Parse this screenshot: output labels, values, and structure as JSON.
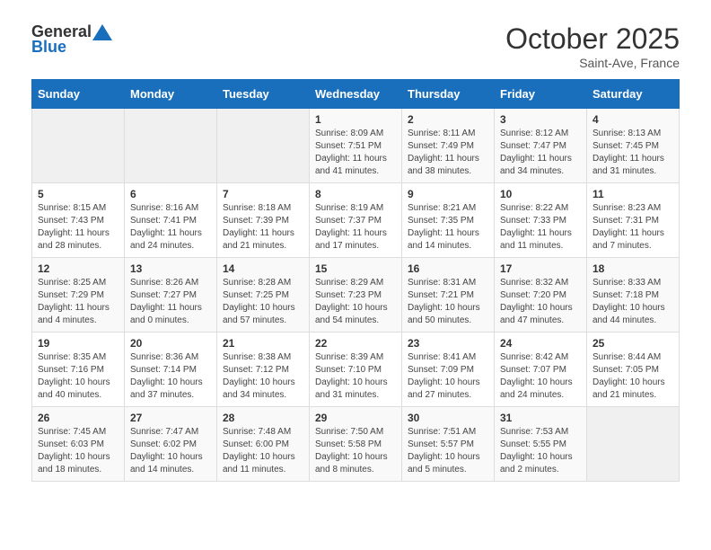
{
  "header": {
    "logo_general": "General",
    "logo_blue": "Blue",
    "month_title": "October 2025",
    "location": "Saint-Ave, France"
  },
  "days_of_week": [
    "Sunday",
    "Monday",
    "Tuesday",
    "Wednesday",
    "Thursday",
    "Friday",
    "Saturday"
  ],
  "weeks": [
    [
      {
        "day": "",
        "info": ""
      },
      {
        "day": "",
        "info": ""
      },
      {
        "day": "",
        "info": ""
      },
      {
        "day": "1",
        "info": "Sunrise: 8:09 AM\nSunset: 7:51 PM\nDaylight: 11 hours and 41 minutes."
      },
      {
        "day": "2",
        "info": "Sunrise: 8:11 AM\nSunset: 7:49 PM\nDaylight: 11 hours and 38 minutes."
      },
      {
        "day": "3",
        "info": "Sunrise: 8:12 AM\nSunset: 7:47 PM\nDaylight: 11 hours and 34 minutes."
      },
      {
        "day": "4",
        "info": "Sunrise: 8:13 AM\nSunset: 7:45 PM\nDaylight: 11 hours and 31 minutes."
      }
    ],
    [
      {
        "day": "5",
        "info": "Sunrise: 8:15 AM\nSunset: 7:43 PM\nDaylight: 11 hours and 28 minutes."
      },
      {
        "day": "6",
        "info": "Sunrise: 8:16 AM\nSunset: 7:41 PM\nDaylight: 11 hours and 24 minutes."
      },
      {
        "day": "7",
        "info": "Sunrise: 8:18 AM\nSunset: 7:39 PM\nDaylight: 11 hours and 21 minutes."
      },
      {
        "day": "8",
        "info": "Sunrise: 8:19 AM\nSunset: 7:37 PM\nDaylight: 11 hours and 17 minutes."
      },
      {
        "day": "9",
        "info": "Sunrise: 8:21 AM\nSunset: 7:35 PM\nDaylight: 11 hours and 14 minutes."
      },
      {
        "day": "10",
        "info": "Sunrise: 8:22 AM\nSunset: 7:33 PM\nDaylight: 11 hours and 11 minutes."
      },
      {
        "day": "11",
        "info": "Sunrise: 8:23 AM\nSunset: 7:31 PM\nDaylight: 11 hours and 7 minutes."
      }
    ],
    [
      {
        "day": "12",
        "info": "Sunrise: 8:25 AM\nSunset: 7:29 PM\nDaylight: 11 hours and 4 minutes."
      },
      {
        "day": "13",
        "info": "Sunrise: 8:26 AM\nSunset: 7:27 PM\nDaylight: 11 hours and 0 minutes."
      },
      {
        "day": "14",
        "info": "Sunrise: 8:28 AM\nSunset: 7:25 PM\nDaylight: 10 hours and 57 minutes."
      },
      {
        "day": "15",
        "info": "Sunrise: 8:29 AM\nSunset: 7:23 PM\nDaylight: 10 hours and 54 minutes."
      },
      {
        "day": "16",
        "info": "Sunrise: 8:31 AM\nSunset: 7:21 PM\nDaylight: 10 hours and 50 minutes."
      },
      {
        "day": "17",
        "info": "Sunrise: 8:32 AM\nSunset: 7:20 PM\nDaylight: 10 hours and 47 minutes."
      },
      {
        "day": "18",
        "info": "Sunrise: 8:33 AM\nSunset: 7:18 PM\nDaylight: 10 hours and 44 minutes."
      }
    ],
    [
      {
        "day": "19",
        "info": "Sunrise: 8:35 AM\nSunset: 7:16 PM\nDaylight: 10 hours and 40 minutes."
      },
      {
        "day": "20",
        "info": "Sunrise: 8:36 AM\nSunset: 7:14 PM\nDaylight: 10 hours and 37 minutes."
      },
      {
        "day": "21",
        "info": "Sunrise: 8:38 AM\nSunset: 7:12 PM\nDaylight: 10 hours and 34 minutes."
      },
      {
        "day": "22",
        "info": "Sunrise: 8:39 AM\nSunset: 7:10 PM\nDaylight: 10 hours and 31 minutes."
      },
      {
        "day": "23",
        "info": "Sunrise: 8:41 AM\nSunset: 7:09 PM\nDaylight: 10 hours and 27 minutes."
      },
      {
        "day": "24",
        "info": "Sunrise: 8:42 AM\nSunset: 7:07 PM\nDaylight: 10 hours and 24 minutes."
      },
      {
        "day": "25",
        "info": "Sunrise: 8:44 AM\nSunset: 7:05 PM\nDaylight: 10 hours and 21 minutes."
      }
    ],
    [
      {
        "day": "26",
        "info": "Sunrise: 7:45 AM\nSunset: 6:03 PM\nDaylight: 10 hours and 18 minutes."
      },
      {
        "day": "27",
        "info": "Sunrise: 7:47 AM\nSunset: 6:02 PM\nDaylight: 10 hours and 14 minutes."
      },
      {
        "day": "28",
        "info": "Sunrise: 7:48 AM\nSunset: 6:00 PM\nDaylight: 10 hours and 11 minutes."
      },
      {
        "day": "29",
        "info": "Sunrise: 7:50 AM\nSunset: 5:58 PM\nDaylight: 10 hours and 8 minutes."
      },
      {
        "day": "30",
        "info": "Sunrise: 7:51 AM\nSunset: 5:57 PM\nDaylight: 10 hours and 5 minutes."
      },
      {
        "day": "31",
        "info": "Sunrise: 7:53 AM\nSunset: 5:55 PM\nDaylight: 10 hours and 2 minutes."
      },
      {
        "day": "",
        "info": ""
      }
    ]
  ]
}
